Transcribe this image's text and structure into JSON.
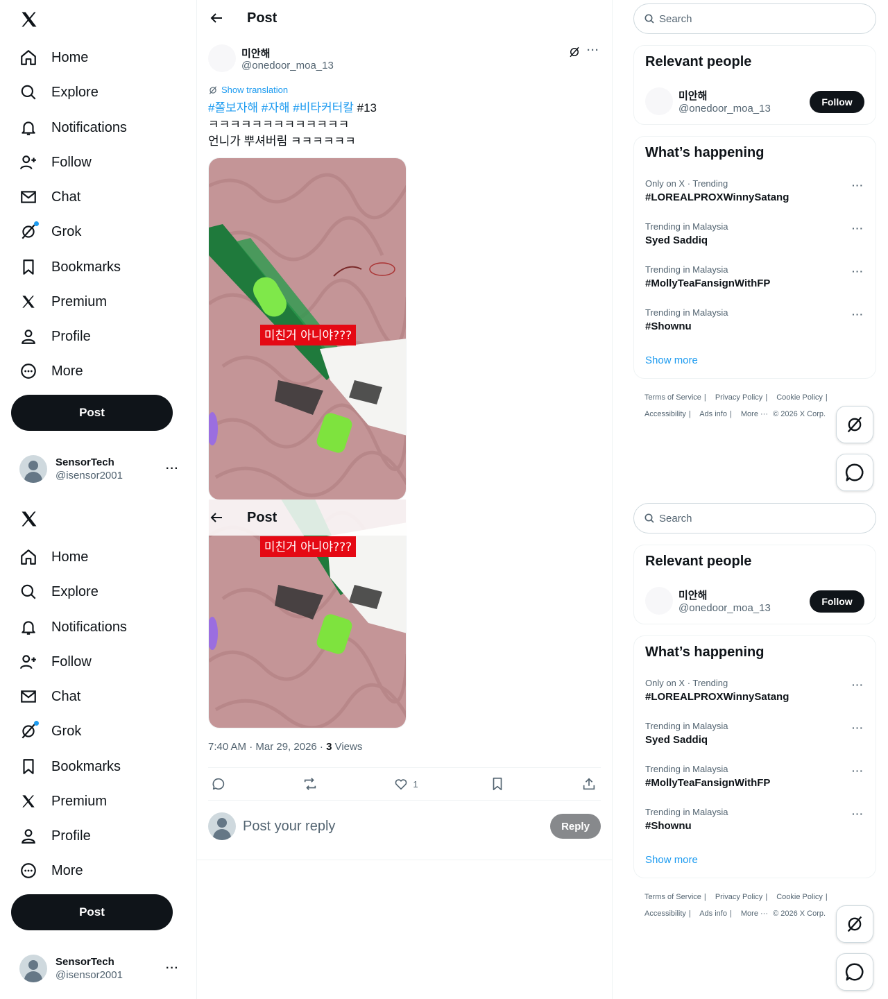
{
  "nav": {
    "items": [
      {
        "label": "Home",
        "icon": "home-icon"
      },
      {
        "label": "Explore",
        "icon": "search-icon"
      },
      {
        "label": "Notifications",
        "icon": "bell-icon"
      },
      {
        "label": "Follow",
        "icon": "person-add-icon"
      },
      {
        "label": "Chat",
        "icon": "mail-icon"
      },
      {
        "label": "Grok",
        "icon": "grok-icon"
      },
      {
        "label": "Bookmarks",
        "icon": "bookmark-icon"
      },
      {
        "label": "Premium",
        "icon": "x-logo-icon"
      },
      {
        "label": "Profile",
        "icon": "person-icon"
      },
      {
        "label": "More",
        "icon": "more-circle-icon"
      }
    ],
    "post_label": "Post",
    "account": {
      "name": "SensorTech",
      "handle": "@isensor2001"
    }
  },
  "header": {
    "title": "Post"
  },
  "tweet": {
    "author_name": "미안해",
    "author_handle": "@onedoor_moa_13",
    "show_translation": "Show translation",
    "hashtags": [
      "#쫄보자해",
      "#자해",
      "#비타커터칼"
    ],
    "tag_plain": "#13",
    "line2": "ㅋㅋㅋㅋㅋㅋㅋㅋㅋㅋㅋㅋㅋ",
    "line3": "언니가 뿌셔버림 ㅋㅋㅋㅋㅋㅋ",
    "image_caption": "미친거 아니야???",
    "time": "7:40 AM · Mar 29, 2026 · ",
    "views_count": "3",
    "views_label": " Views",
    "likes": "1"
  },
  "reply": {
    "placeholder": "Post your reply",
    "button": "Reply"
  },
  "search": {
    "placeholder": "Search"
  },
  "relevant": {
    "title": "Relevant people",
    "name": "미안해",
    "handle": "@onedoor_moa_13",
    "follow": "Follow"
  },
  "happening": {
    "title": "What’s happening",
    "trends": [
      {
        "context": "Only on X · Trending",
        "name": "#LOREALPROXWinnySatang"
      },
      {
        "context": "Trending in Malaysia",
        "name": "Syed Saddiq"
      },
      {
        "context": "Trending in Malaysia",
        "name": "#MollyTeaFansignWithFP"
      },
      {
        "context": "Trending in Malaysia",
        "name": "#Shownu"
      }
    ],
    "show_more": "Show more"
  },
  "footer": {
    "terms": "Terms of Service",
    "privacy": "Privacy Policy",
    "cookie": "Cookie Policy",
    "accessibility": "Accessibility",
    "ads": "Ads info",
    "more": "More ···",
    "copyright": "© 2026 X Corp."
  },
  "colors": {
    "accent": "#1d9bf0",
    "dark": "#0f1419",
    "muted": "#536471",
    "caption_bg": "#e50914"
  }
}
